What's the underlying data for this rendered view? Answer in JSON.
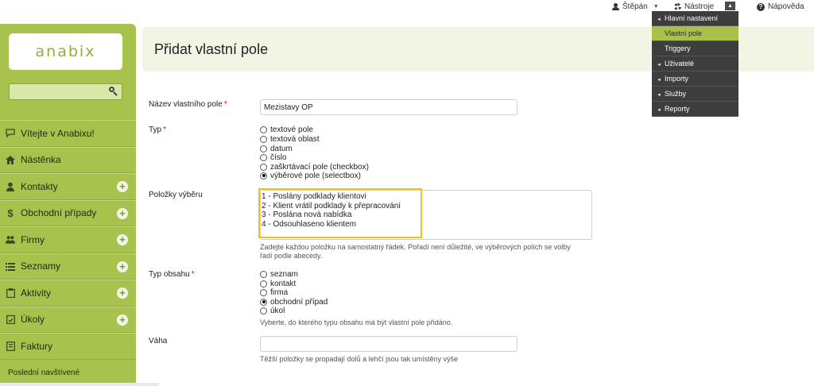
{
  "topbar": {
    "user": "Štěpán",
    "tools": "Nástroje",
    "help": "Nápověda"
  },
  "tools_menu": {
    "items": [
      {
        "label": "Hlavní nastavení",
        "type": "group"
      },
      {
        "label": "Vlastní pole",
        "type": "sub",
        "active": true
      },
      {
        "label": "Triggery",
        "type": "sub"
      },
      {
        "label": "Uživatelé",
        "type": "group"
      },
      {
        "label": "Importy",
        "type": "group"
      },
      {
        "label": "Služby",
        "type": "group"
      },
      {
        "label": "Reporty",
        "type": "group"
      }
    ]
  },
  "sidebar": {
    "logo": "anabix",
    "search_placeholder": "",
    "items": [
      {
        "label": "Vítejte v Anabixu!",
        "icon": "chat-icon",
        "plus": false
      },
      {
        "label": "Nástěnka",
        "icon": "home-icon",
        "plus": false
      },
      {
        "label": "Kontakty",
        "icon": "person-icon",
        "plus": true
      },
      {
        "label": "Obchodní případy",
        "icon": "dollar-icon",
        "plus": true
      },
      {
        "label": "Firmy",
        "icon": "group-icon",
        "plus": true
      },
      {
        "label": "Seznamy",
        "icon": "list-icon",
        "plus": true
      },
      {
        "label": "Aktivity",
        "icon": "clipboard-icon",
        "plus": true
      },
      {
        "label": "Úkoly",
        "icon": "checklist-icon",
        "plus": true
      },
      {
        "label": "Faktury",
        "icon": "invoice-icon",
        "plus": false
      }
    ],
    "recent": "Poslední navštívené"
  },
  "page": {
    "title": "Přidat vlastní pole"
  },
  "form": {
    "name": {
      "label": "Název vlastního pole",
      "value": "Mezistavy OP"
    },
    "type": {
      "label": "Typ",
      "options": [
        {
          "label": "textové pole",
          "checked": false
        },
        {
          "label": "textová oblast",
          "checked": false
        },
        {
          "label": "datum",
          "checked": false
        },
        {
          "label": "číslo",
          "checked": false
        },
        {
          "label": "zaškrtávací pole (checkbox)",
          "checked": false
        },
        {
          "label": "výběrové pole (selectbox)",
          "checked": true
        }
      ]
    },
    "choices": {
      "label": "Položky výběru",
      "lines": [
        "1 - Poslány podklady klientovi",
        "2 - Klient vrátil podklady k přepracování",
        "3 - Poslána nová nabídka",
        "4 - Odsouhlaseno klientem"
      ],
      "hint_line1": "Zadejte každou položku na samostatný řádek. Pořadí není důležité, ve výběrových polích se volby",
      "hint_line2": "řadí podle abecedy."
    },
    "content_type": {
      "label": "Typ obsahu",
      "options": [
        {
          "label": "seznam",
          "checked": false
        },
        {
          "label": "kontakt",
          "checked": false
        },
        {
          "label": "firma",
          "checked": false
        },
        {
          "label": "obchodní případ",
          "checked": true
        },
        {
          "label": "úkol",
          "checked": false
        }
      ],
      "hint": "Vyberte, do kterého typu obsahu má být vlastní pole přidáno."
    },
    "weight": {
      "label": "Váha",
      "value": "",
      "hint": "Těžší položky se propadají dolů a lehčí jsou tak umístěny výše"
    }
  },
  "colors": {
    "sidebar": "#a8c34d",
    "menu_bg": "#3d3d3d",
    "menu_active": "#a7c14a",
    "highlight": "#f0c21d",
    "required": "#cc1111"
  }
}
